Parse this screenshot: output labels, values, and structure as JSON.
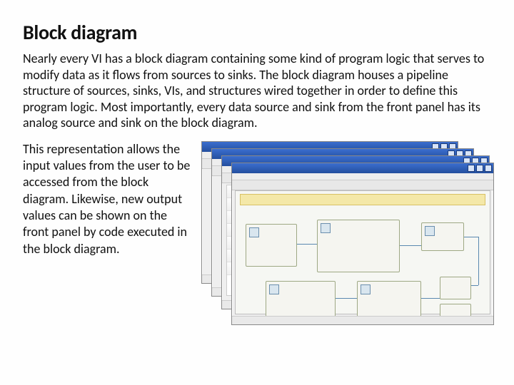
{
  "title": "Block diagram",
  "para1": "Nearly every VI has a block diagram containing some kind of program logic that serves to modify data as it flows from sources to sinks. The block diagram houses a pipeline structure of sources, sinks, VIs, and structures wired together in order to define this program logic. Most importantly, every data source and sink from the front panel has its analog source and sink on the block diagram.",
  "para2": "This representation allows the input values from the user to be accessed from the block diagram. Likewise, new output values can be shown on the front panel by code executed in the block diagram."
}
